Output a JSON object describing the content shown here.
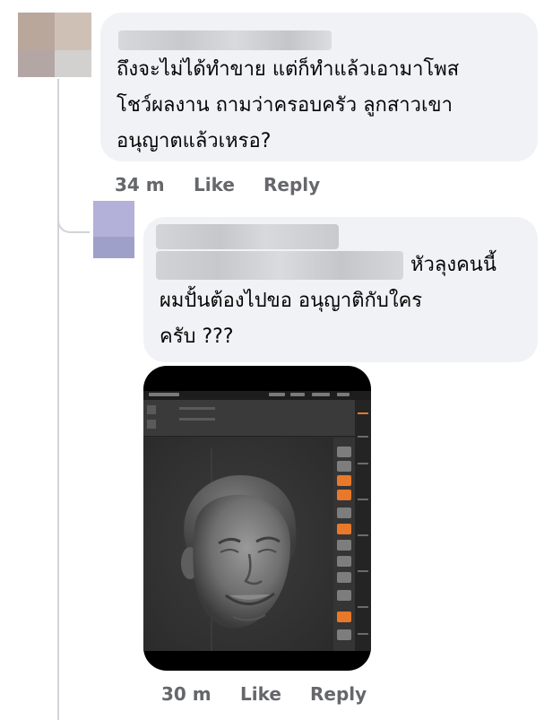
{
  "main_comment": {
    "text_lines": [
      "ถึงจะไม่ได้ทำขาย แต่ก็ทำแล้วเอามาโพส",
      "โชว์ผลงาน ถามว่าครอบครัว ลูกสาวเขา",
      "อนุญาตแล้วเหรอ?"
    ],
    "actions": {
      "time": "34 m",
      "like": "Like",
      "reply": "Reply"
    }
  },
  "reply_comment": {
    "text_lines": [
      "หัวลุงคนนี้",
      "ผมปั้นต้องไปขอ อนุญาติกับใคร",
      "ครับ ???"
    ],
    "actions": {
      "time": "30 m",
      "like": "Like",
      "reply": "Reply"
    }
  },
  "colors": {
    "bubble": "#f0f2f5",
    "action_text": "#65676b",
    "zbrush_accent": "#e8782a"
  },
  "icons": {
    "attachment": "3d-sculpt-screenshot"
  }
}
